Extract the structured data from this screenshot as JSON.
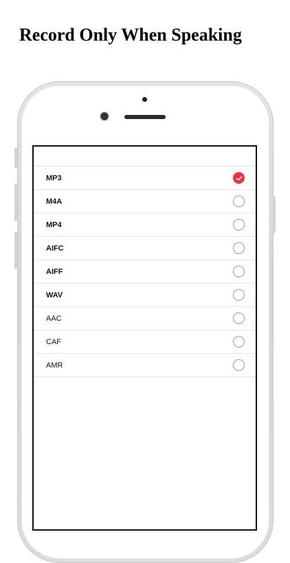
{
  "headline": "Record Only When Speaking",
  "formats": [
    {
      "label": "MP3",
      "checked": true,
      "bold": true
    },
    {
      "label": "M4A",
      "checked": false,
      "bold": true
    },
    {
      "label": "MP4",
      "checked": false,
      "bold": true
    },
    {
      "label": "AIFC",
      "checked": false,
      "bold": true
    },
    {
      "label": "AIFF",
      "checked": false,
      "bold": true
    },
    {
      "label": "WAV",
      "checked": false,
      "bold": true
    },
    {
      "label": "AAC",
      "checked": false,
      "bold": false
    },
    {
      "label": "CAF",
      "checked": false,
      "bold": false
    },
    {
      "label": "AMR",
      "checked": false,
      "bold": false
    }
  ],
  "colors": {
    "accent": "#ef3344"
  },
  "icons": {
    "check": "checkmark-icon"
  }
}
